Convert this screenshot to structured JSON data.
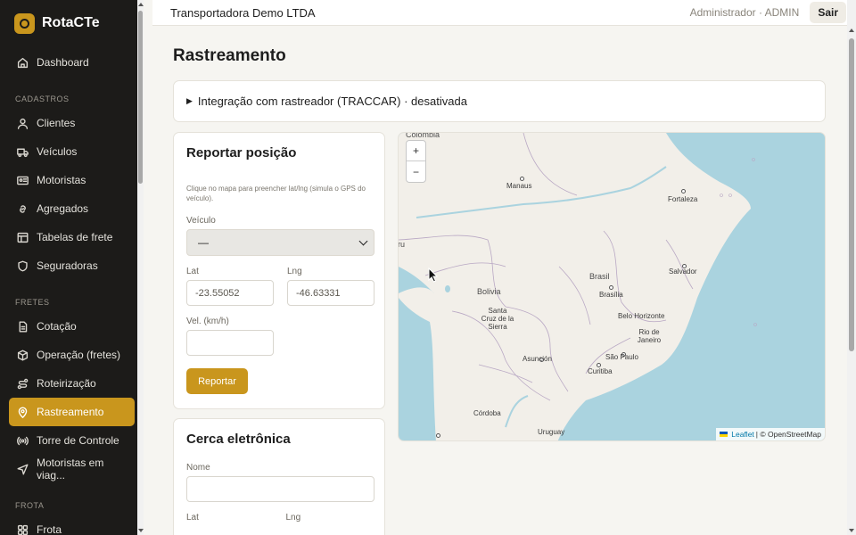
{
  "app": {
    "name": "RotaCTe"
  },
  "sidebar": {
    "items_top": [
      {
        "label": "Dashboard",
        "icon": "home-icon"
      }
    ],
    "section_cadastros": "CADASTROS",
    "cadastros": [
      {
        "label": "Clientes",
        "icon": "user-icon"
      },
      {
        "label": "Veículos",
        "icon": "truck-icon"
      },
      {
        "label": "Motoristas",
        "icon": "id-card-icon"
      },
      {
        "label": "Agregados",
        "icon": "link-icon"
      },
      {
        "label": "Tabelas de frete",
        "icon": "table-icon"
      },
      {
        "label": "Seguradoras",
        "icon": "shield-icon"
      }
    ],
    "section_fretes": "FRETES",
    "fretes": [
      {
        "label": "Cotação",
        "icon": "document-icon"
      },
      {
        "label": "Operação (fretes)",
        "icon": "box-icon"
      },
      {
        "label": "Roteirização",
        "icon": "route-icon"
      },
      {
        "label": "Rastreamento",
        "icon": "map-pin-icon",
        "active": true
      },
      {
        "label": "Torre de Controle",
        "icon": "broadcast-icon"
      },
      {
        "label": "Motoristas em viag...",
        "icon": "navigation-icon"
      }
    ],
    "section_frota": "FROTA",
    "frota": [
      {
        "label": "Frota",
        "icon": "grid-icon"
      }
    ]
  },
  "topbar": {
    "company": "Transportadora Demo LTDA",
    "user": "Administrador · ADMIN",
    "logout": "Sair"
  },
  "page": {
    "title": "Rastreamento",
    "integration": "Integração com rastreador (TRACCAR) · desativada"
  },
  "report": {
    "title": "Reportar posição",
    "hint": "Clique no mapa para preencher lat/lng (simula o GPS do veículo).",
    "vehicle_label": "Veículo",
    "vehicle_value": "—",
    "lat_label": "Lat",
    "lat_placeholder": "-23.55052",
    "lng_label": "Lng",
    "lng_placeholder": "-46.63331",
    "speed_label": "Vel. (km/h)",
    "submit": "Reportar"
  },
  "geofence": {
    "title": "Cerca eletrônica",
    "name_label": "Nome",
    "lat_label": "Lat",
    "lng_label": "Lng"
  },
  "map": {
    "zoom_in": "+",
    "zoom_out": "−",
    "labels": {
      "colombia": "Colombia",
      "manaus": "Manaus",
      "fortaleza": "Fortaleza",
      "brasil": "Brasil",
      "brasilia": "Brasília",
      "salvador": "Salvador",
      "bolivia": "Bolivia",
      "santa_cruz": "Santa Cruz de la Sierra",
      "belo_horizonte": "Belo Horizonte",
      "rio": "Rio de Janeiro",
      "asuncion": "Asunción",
      "sao_paulo": "São Paulo",
      "curitiba": "Curitiba",
      "cordoba": "Córdoba",
      "uruguay": "Uruguay",
      "peru_fragment": "ru"
    },
    "attribution_leaflet": "Leaflet",
    "attribution_osm": "| © OpenStreetMap"
  }
}
